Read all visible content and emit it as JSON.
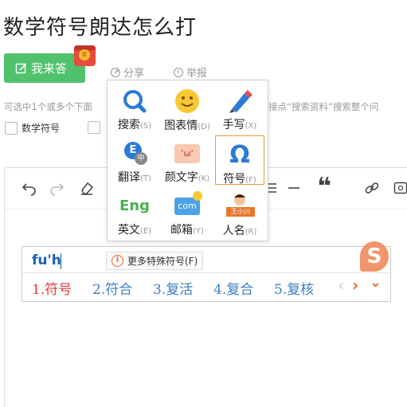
{
  "page": {
    "title": "数学符号朗达怎么打"
  },
  "answer_button": {
    "label": "我来答",
    "redpack_char": "奖"
  },
  "actions": {
    "share": "分享",
    "report": "举报"
  },
  "hint": {
    "left": "可选中1个或多个下面",
    "right": "接点“搜索资料”搜索整个问"
  },
  "checkboxes": [
    {
      "label": "数学符号"
    },
    {
      "label": ""
    }
  ],
  "toolbar": {
    "quote_glyph": "❝"
  },
  "ime_menu": {
    "items": [
      {
        "label": "搜索",
        "key": "(S)",
        "icon": "search-icon"
      },
      {
        "label": "图表情",
        "key": "(D)",
        "icon": "emoji-icon"
      },
      {
        "label": "手写",
        "key": "(X)",
        "icon": "pen-icon"
      },
      {
        "label": "翻译",
        "key": "(T)",
        "icon": "translate-icon",
        "badge": "E",
        "badge2": "中"
      },
      {
        "label": "颜文字",
        "key": "(K)",
        "icon": "kaomoji-icon",
        "face": "'ω'"
      },
      {
        "label": "符号",
        "key": "(F)",
        "icon": "omega-symbol-icon",
        "glyph": "Ω"
      },
      {
        "label": "英文",
        "key": "(E)",
        "icon": "english-icon",
        "glyph": "Eng"
      },
      {
        "label": "邮箱",
        "key": "(Y)",
        "icon": "mail-icon",
        "glyph": "com"
      },
      {
        "label": "人名",
        "key": "(R)",
        "icon": "person-icon",
        "tag": "王小川"
      }
    ],
    "selected": "符号",
    "colors": {
      "selected_border": "#f0962e",
      "blue": "#2b7bd6"
    }
  },
  "ime_bar": {
    "pinyin": "fu'h",
    "more_symbols": "更多特殊符号(F)",
    "more_icon": "i",
    "logo_glyph": "S",
    "candidates": [
      "1.符号",
      "2.符合",
      "3.复活",
      "4.复合",
      "5.复核"
    ],
    "prev_arrow": "‹",
    "next_arrow": "›",
    "expand_arrow": "⌄"
  }
}
